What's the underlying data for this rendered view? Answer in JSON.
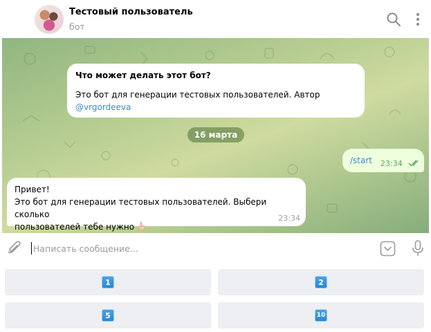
{
  "header": {
    "title": "Тестовый пользователь",
    "subtitle": "бот",
    "icons": [
      "search-icon",
      "kebab-menu-icon"
    ]
  },
  "chat": {
    "info_card": {
      "title": "Что может делать этот бот?",
      "text": "Это бот для генерации тестовых пользователей. Автор",
      "author_link": "@vrgordeeva"
    },
    "date_separator": "16 марта",
    "outgoing": {
      "text": "/start",
      "time": "23:34",
      "status": "read"
    },
    "incoming": {
      "line1": "Привет!",
      "line2": "Это бот для генерации тестовых пользователей. Выбери сколько",
      "line3": "пользователей тебе нужно",
      "emoji": "point-down-hand",
      "time": "23:34"
    }
  },
  "composer": {
    "placeholder": "Написать сообщение...",
    "value": ""
  },
  "keyboard": {
    "buttons": [
      "1",
      "2",
      "5",
      "10"
    ]
  },
  "colors": {
    "link": "#3a8bc9",
    "outgoing_bubble": "#eeffde",
    "read_check": "#5fa861",
    "key_badge": "#2a86d3"
  }
}
